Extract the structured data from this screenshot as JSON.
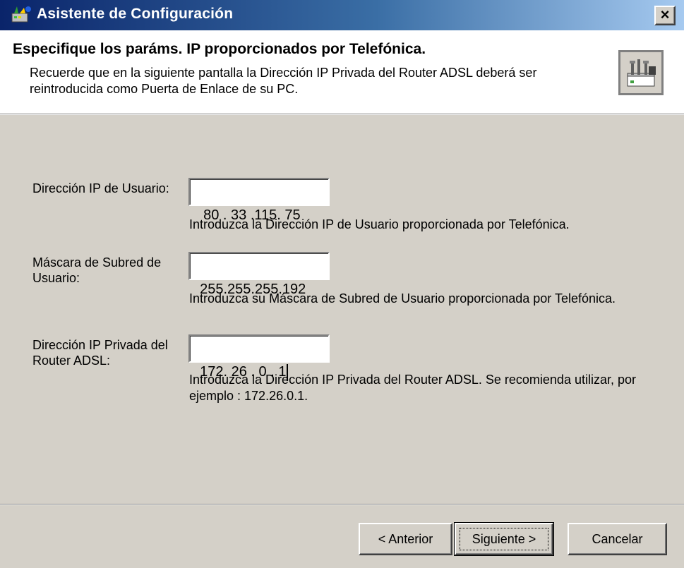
{
  "window": {
    "title": "Asistente de Configuración",
    "close_glyph": "×"
  },
  "header": {
    "title": "Especifique los paráms. IP proporcionados por Telefónica.",
    "description": "Recuerde que en la siguiente pantalla la Dirección IP Privada del Router ADSL deberá ser reintroducida como Puerta de Enlace de su PC.",
    "icon": "network-device-icon"
  },
  "fields": {
    "user_ip": {
      "label": "Dirección IP de Usuario:",
      "value": "80 . 33 .115. 75",
      "hint": "Introduzca la Dirección IP de Usuario proporcionada por Telefónica."
    },
    "subnet_mask": {
      "label": "Máscara de Subred de Usuario:",
      "value": "255.255.255.192",
      "hint": "Introduzca su Máscara de Subred de Usuario proporcionada por Telefónica."
    },
    "router_ip": {
      "label": "Dirección IP Privada del Router ADSL:",
      "value": "172. 26 . 0 . 1",
      "hint": "Introduzca la Dirección IP Privada del Router ADSL. Se recomienda utilizar, por ejemplo : 172.26.0.1."
    }
  },
  "buttons": {
    "back": "< Anterior",
    "next": "Siguiente >",
    "cancel": "Cancelar"
  },
  "colors": {
    "titlebar_start": "#0a246a",
    "titlebar_end": "#a6caf0",
    "face": "#d4d0c8"
  }
}
